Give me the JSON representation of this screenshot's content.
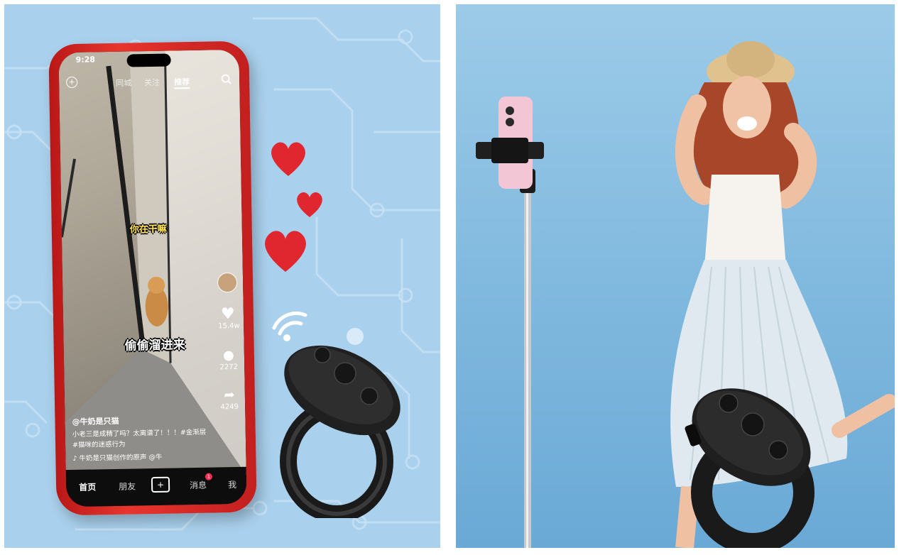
{
  "phone": {
    "status_time": "9:28",
    "top_tabs": [
      "同城",
      "关注",
      "推荐"
    ],
    "overlay_texts": [
      "你在干嘛",
      "偷偷溜进来"
    ],
    "side_counts": [
      "15.4w",
      "2272",
      "4249"
    ],
    "author": "@牛奶是只猫",
    "caption_line1": "小老三是成精了吗？太离谱了！！！#金渐层",
    "caption_line2": "#猫咪的迷惑行为",
    "music": "♪ 牛奶是只猫创作的原声 @牛",
    "bottom_tabs": [
      "首页",
      "朋友",
      "+",
      "消息",
      "我"
    ],
    "message_badge": "1"
  },
  "colors": {
    "left_bg": "#a9d0ec",
    "right_bg": "#8cc2e4",
    "heart": "#e0262e",
    "phone_body": "#d62a24"
  },
  "icons": [
    "heart-icon",
    "wifi-signal-icon",
    "search-icon",
    "plus-icon",
    "comment-icon",
    "share-icon"
  ]
}
